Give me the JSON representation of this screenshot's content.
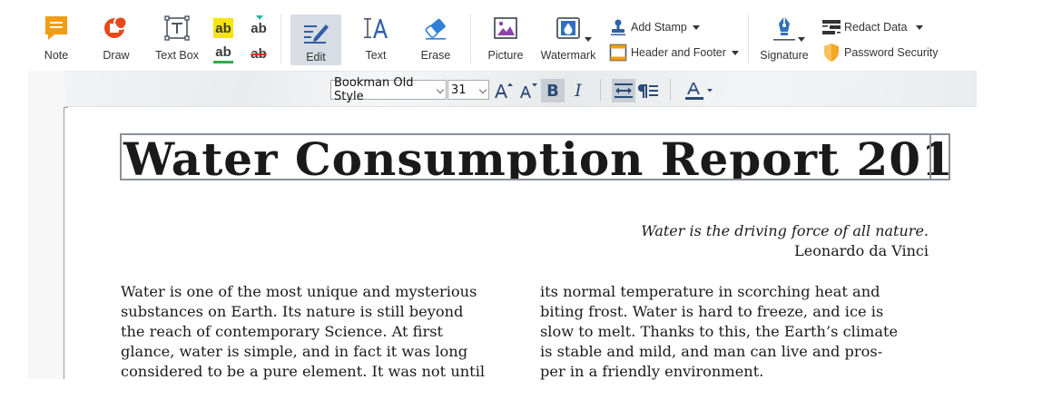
{
  "toolbar": {
    "note": "Note",
    "draw": "Draw",
    "text_box": "Text Box",
    "edit": "Edit",
    "text": "Text",
    "erase": "Erase",
    "picture": "Picture",
    "watermark": "Watermark",
    "add_stamp": "Add Stamp",
    "header_footer": "Header and Footer",
    "signature": "Signature",
    "redact_data": "Redact Data",
    "password_security": "Password Security",
    "highlight_glyph": "ab",
    "active_tool": "Edit"
  },
  "format_bar": {
    "font_family": "Bookman Old Style",
    "font_size": "31",
    "bold_active": true,
    "colors": {
      "accent": "#2a4a78",
      "active_bg": "#c9ced6"
    }
  },
  "document": {
    "title": "Water Consumption Report 201",
    "quote_text": "Water is the driving force of all nature.",
    "quote_author": "Leonardo da Vinci",
    "column1_lines": [
      "Water is one of the most unique and mysterious",
      "substances on Earth. Its nature is still beyond",
      "the reach of contemporary Science. At first",
      "glance, water is simple, and in fact it was long",
      "considered to be a pure element. It was not until"
    ],
    "column2_lines": [
      "its normal temperature in scorching heat and",
      "biting frost. Water is hard to freeze, and ice is",
      "slow to melt. Thanks to this, the Earth’s climate",
      "is stable and mild, and man can live and pros-",
      "per in a friendly environment."
    ]
  },
  "icons": {
    "note": "note-icon",
    "draw": "draw-icon",
    "text_box": "text-box-icon",
    "edit": "edit-icon",
    "text": "text-icon",
    "erase": "eraser-icon",
    "picture": "picture-icon",
    "watermark": "watermark-icon",
    "stamp": "stamp-icon",
    "header_footer": "header-footer-icon",
    "signature": "signature-pen-icon",
    "redact": "redact-icon",
    "security": "shield-icon"
  }
}
